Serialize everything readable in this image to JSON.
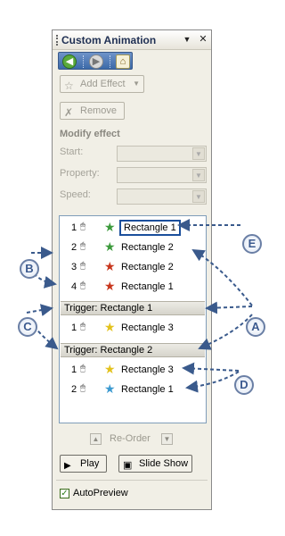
{
  "pane": {
    "title": "Custom Animation",
    "dropdown_icon": "▼",
    "close_icon": "✕",
    "nav": {
      "back_icon": "back-arrow",
      "forward_icon": "forward-arrow",
      "home_icon": "home"
    },
    "add_effect_label": "Add Effect",
    "remove_label": "Remove",
    "modify_effect": "Modify effect",
    "fields": [
      {
        "label": "Start:"
      },
      {
        "label": "Property:"
      },
      {
        "label": "Speed:"
      }
    ],
    "reorder_label": "Re-Order",
    "play_label": "Play",
    "slideshow_label": "Slide Show",
    "autopreview_label": "AutoPreview"
  },
  "list": {
    "items": [
      {
        "num": "1",
        "name": "Rectangle 1"
      },
      {
        "num": "2",
        "name": "Rectangle 2"
      },
      {
        "num": "3",
        "name": "Rectangle 2"
      },
      {
        "num": "4",
        "name": "Rectangle 1"
      }
    ],
    "trigger1": "Trigger: Rectangle 1",
    "trigger1_items": [
      {
        "num": "1",
        "name": "Rectangle 3"
      }
    ],
    "trigger2": "Trigger: Rectangle 2",
    "trigger2_items": [
      {
        "num": "1",
        "name": "Rectangle 3"
      },
      {
        "num": "2",
        "name": "Rectangle 1"
      }
    ]
  },
  "callouts": {
    "a": "A",
    "b": "B",
    "c": "C",
    "d": "D",
    "e": "E"
  },
  "colors": {
    "arrow": "#3a5a8c",
    "selection_border": "#1b4f9c",
    "star_green": "#3c9a3c",
    "star_red": "#c8361d",
    "star_yellow": "#e3c21d"
  }
}
